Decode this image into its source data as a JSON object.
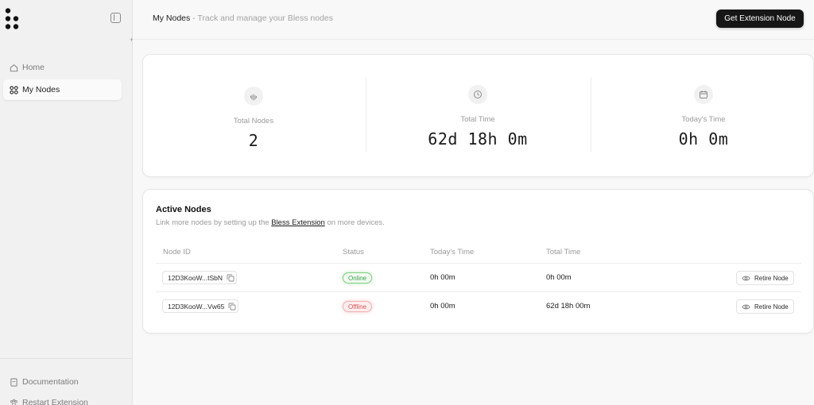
{
  "sidebar": {
    "nav": [
      {
        "label": "Home",
        "icon": "home-icon"
      },
      {
        "label": "My Nodes",
        "icon": "nodes-icon"
      }
    ],
    "bottom": [
      {
        "label": "Documentation",
        "icon": "document-icon"
      },
      {
        "label": "Restart Extension",
        "icon": "paw-icon"
      }
    ]
  },
  "header": {
    "title": "My Nodes",
    "subtitle": " - Track and manage your Bless nodes",
    "cta_label": "Get Extension Node"
  },
  "stats": [
    {
      "label": "Total Nodes",
      "value": "2",
      "icon": "fingerprint-icon"
    },
    {
      "label": "Total Time",
      "value": "62d 18h 0m",
      "icon": "clock-icon"
    },
    {
      "label": "Today's Time",
      "value": "0h 0m",
      "icon": "calendar-icon"
    }
  ],
  "active_nodes": {
    "title": "Active Nodes",
    "subtitle_before": "Link more nodes by setting up the ",
    "subtitle_link": "Bless Extension",
    "subtitle_after": " on more devices.",
    "columns": [
      "Node ID",
      "Status",
      "Today's Time",
      "Total Time"
    ],
    "rows": [
      {
        "node_id": "12D3KooW...tSbN",
        "status": "Online",
        "today_time": "0h 00m",
        "total_time": "0h 00m",
        "action": "Retire Node"
      },
      {
        "node_id": "12D3KooW...Vw65",
        "status": "Offline",
        "today_time": "0h 00m",
        "total_time": "62d 18h 00m",
        "action": "Retire Node"
      }
    ]
  },
  "colors": {
    "primary_button": "#161616",
    "online": "#3aa04a",
    "offline": "#e05555"
  }
}
